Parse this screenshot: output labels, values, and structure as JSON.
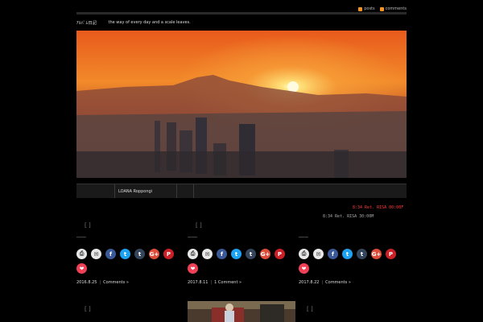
{
  "topbar": {
    "feed1": "posts",
    "feed2": "comments"
  },
  "header": {
    "logo": "ｱﾙﾊﾞﾑ日記",
    "tagline": "the way of every day and a scale leaves."
  },
  "hero": {
    "caption": "LOANA Roppongi"
  },
  "alert": "8:34 Ret. RISA 00:00F",
  "thumb_placeholder": "[ ]",
  "posts": [
    {
      "stamp": "",
      "date": "2016.8.25",
      "comments": "Comments »"
    },
    {
      "stamp": "",
      "date": "2017.8.11",
      "comments": "1 Comment »"
    },
    {
      "stamp": "8:34 Ret. RISA 30:00M",
      "date": "2017.8.22",
      "comments": "Comments »"
    }
  ],
  "share_icons": [
    {
      "name": "print-icon",
      "glyph": "⎙",
      "color": "#e8e8e8",
      "fg": "#333"
    },
    {
      "name": "email-icon",
      "glyph": "✉",
      "color": "#e8e8e8",
      "fg": "#333"
    },
    {
      "name": "facebook-icon",
      "glyph": "f",
      "color": "#3b5998",
      "fg": "#fff"
    },
    {
      "name": "twitter-icon",
      "glyph": "t",
      "color": "#1da1f2",
      "fg": "#fff"
    },
    {
      "name": "tumblr-icon",
      "glyph": "t",
      "color": "#35465c",
      "fg": "#fff"
    },
    {
      "name": "google-plus-icon",
      "glyph": "G+",
      "color": "#dd4b39",
      "fg": "#fff"
    },
    {
      "name": "pinterest-icon",
      "glyph": "P",
      "color": "#cb2027",
      "fg": "#fff"
    },
    {
      "name": "pocket-icon",
      "glyph": "❤",
      "color": "#ef4056",
      "fg": "#fff"
    }
  ]
}
